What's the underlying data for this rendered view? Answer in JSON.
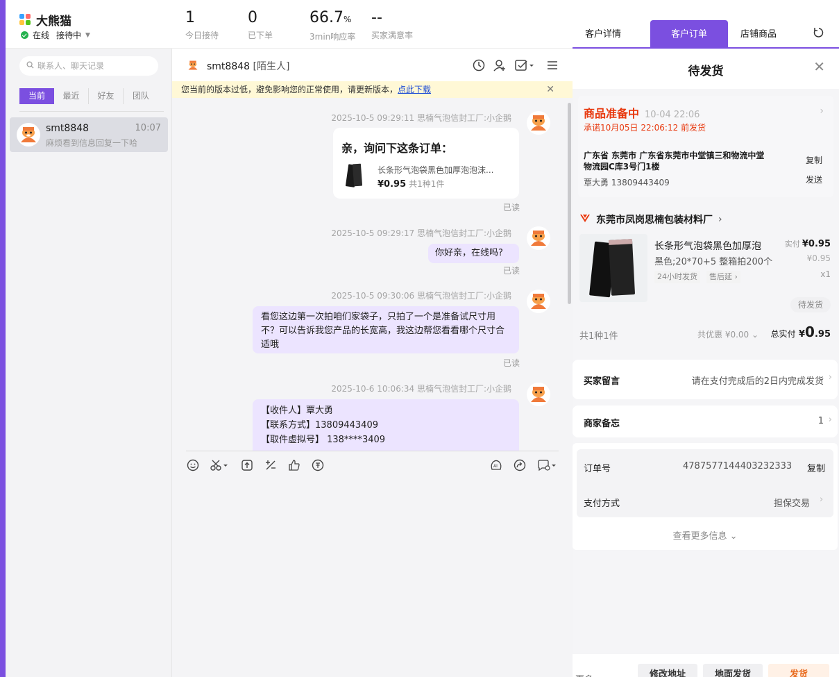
{
  "header": {
    "brand": "大熊猫",
    "status": "在线",
    "mode": "接待中",
    "stats": [
      {
        "value": "1",
        "unit": "",
        "label": "今日接待"
      },
      {
        "value": "0",
        "unit": "",
        "label": "已下单"
      },
      {
        "value": "66.7",
        "unit": "%",
        "label": "3min响应率"
      },
      {
        "value": "--",
        "unit": "",
        "label": "买家满意率"
      }
    ]
  },
  "contacts": {
    "search_placeholder": "联系人、聊天记录",
    "tabs": [
      "当前",
      "最近",
      "好友",
      "团队"
    ],
    "active_tab": "当前",
    "items": [
      {
        "name": "smt8848",
        "time": "10:07",
        "preview": "麻烦看到信息回复一下哈"
      }
    ]
  },
  "chat": {
    "contact_name": "smt8848",
    "contact_tag": "[陌生人]",
    "notice_text": "您当前的版本过低，避免影响您的正常使用，请更新版本，",
    "notice_link": "点此下载",
    "read_label": "已读",
    "messages": [
      {
        "meta": "2025-10-5 09:29:11 思楠气泡信封工厂:小企鹅",
        "type": "card",
        "card_title": "亲，询问下这条订单：",
        "product": "长条形气泡袋黑色加厚泡泡沫...",
        "price": "¥0.95",
        "count": "共1种1件"
      },
      {
        "meta": "2025-10-5 09:29:17 思楠气泡信封工厂:小企鹅",
        "type": "text",
        "text": "你好亲，在线吗?"
      },
      {
        "meta": "2025-10-5 09:30:06 思楠气泡信封工厂:小企鹅",
        "type": "text",
        "text": "看您这边第一次拍咱们家袋子，只拍了一个是准备试尺寸用不？可以告诉我您产品的长宽高，我这边帮您看看哪个尺寸合适哦"
      },
      {
        "meta": "2025-10-6 10:06:34 思楠气泡信封工厂:小企鹅",
        "type": "text",
        "lines": [
          "【收件人】覃大勇",
          "【联系方式】13809443409",
          "【取件虚拟号】 138****3409"
        ]
      }
    ]
  },
  "right": {
    "tabs": [
      "客户详情",
      "客户订单",
      "店铺商品"
    ],
    "active_tab": "客户订单",
    "order_title": "待发货",
    "status": {
      "title": "商品准备中",
      "time": "10-04 22:06",
      "promise": "承诺10月05日 22:06:12 前发货",
      "address": "广东省 东莞市 广东省东莞市中堂镇三和物流中堂物流园C库3号门1楼",
      "person": "覃大勇 13809443409",
      "copy": "复制",
      "send": "发送"
    },
    "shop_name": "东莞市凤岗思楠包装材料厂",
    "product": {
      "name": "长条形气泡袋黑色加厚泡",
      "spec": "黑色;20*70+5 整箱拍200个",
      "tags": [
        "24小时发货",
        "售后延"
      ],
      "real_label": "实付",
      "real_price": "¥0.95",
      "orig_price": "¥0.95",
      "qty": "x1",
      "status": "待发货"
    },
    "summary": {
      "count": "共1种1件",
      "discount": "共优惠 ¥0.00",
      "total_label": "总实付",
      "total_symbol": "¥",
      "total_int": "0",
      "total_dec": ".95"
    },
    "buyer_note_label": "买家留言",
    "buyer_note_value": "请在支付完成后的2日内完成发货",
    "merchant_memo_label": "商家备忘",
    "merchant_memo_value": "1",
    "order_no_label": "订单号",
    "order_no": "4787577144403232333",
    "order_copy": "复制",
    "pay_label": "支付方式",
    "pay_value": "担保交易",
    "more_info": "查看更多信息",
    "bottom": [
      "更多",
      "修改地址",
      "地面发货",
      "发货"
    ]
  },
  "colors": {
    "accent": "#7b4fe0",
    "alert": "#e8390f"
  }
}
